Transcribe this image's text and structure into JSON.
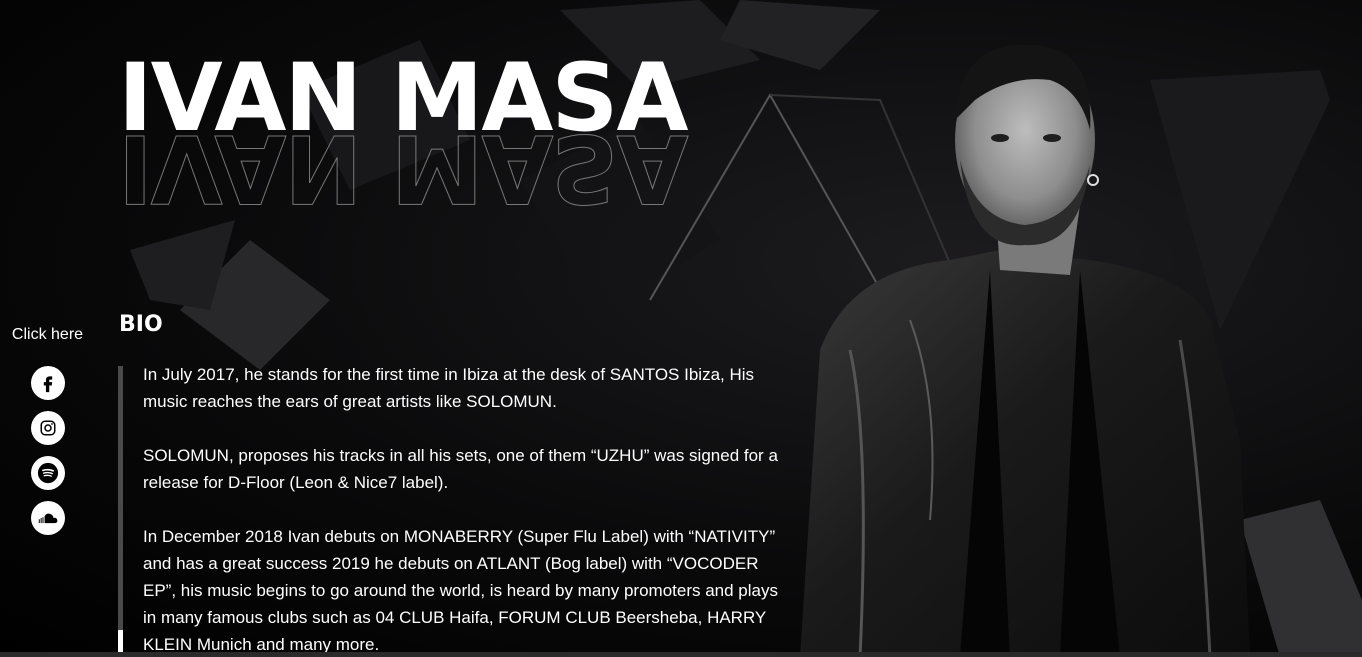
{
  "artist": {
    "name": "IVAN MASA"
  },
  "social": {
    "click_label": "Click here",
    "links": [
      {
        "icon": "facebook-icon"
      },
      {
        "icon": "instagram-icon"
      },
      {
        "icon": "spotify-icon"
      },
      {
        "icon": "soundcloud-icon"
      }
    ]
  },
  "bio": {
    "heading": "BIO",
    "paragraphs": [
      "In July 2017, he stands for the first time in Ibiza at the desk of SANTOS Ibiza, His music reaches the ears of great artists like SOLOMUN.",
      "SOLOMUN, proposes his tracks in all his sets, one of them “UZHU” was signed for a release for D-Floor (Leon & Nice7 label).",
      "In December 2018 Ivan debuts on MONABERRY (Super Flu Label) with “NATIVITY” and has a great success 2019 he debuts on ATLANT (Bog label) with “VOCODER EP”, his music begins to go around the world, is heard by many promoters and plays in many famous clubs such as 04 CLUB Haifa, FORUM CLUB Beersheba, HARRY KLEIN Munich and many more."
    ]
  },
  "colors": {
    "background": "#000000",
    "text": "#ffffff",
    "scrollbar_track": "#4a4a4a"
  }
}
